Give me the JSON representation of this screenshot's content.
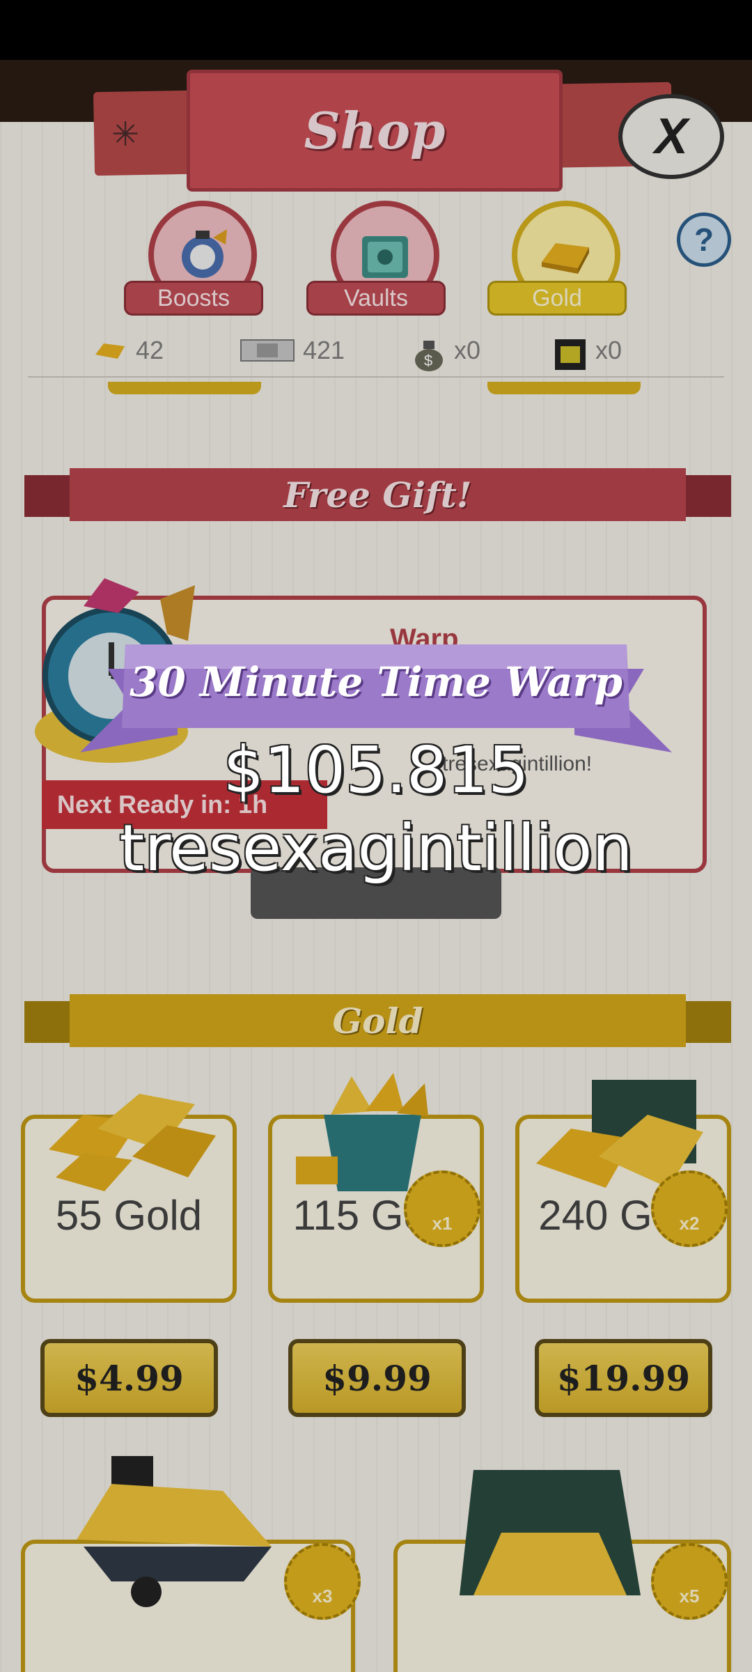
{
  "header": {
    "title": "Shop",
    "close_label": "X"
  },
  "tabs": [
    {
      "label": "Boosts",
      "selected": false
    },
    {
      "label": "Vaults",
      "selected": false
    },
    {
      "label": "Gold",
      "selected": true
    }
  ],
  "help_label": "?",
  "currencies": [
    {
      "icon": "gold-bar-icon",
      "value": "42"
    },
    {
      "icon": "megabucks-icon",
      "value": "421"
    },
    {
      "icon": "money-bag-icon",
      "value": "x0"
    },
    {
      "icon": "angel-ticket-icon",
      "value": "x0"
    }
  ],
  "free_gift": {
    "section_title": "Free Gift!",
    "card_title": "Warp",
    "card_desc": "tresexagintillion!",
    "next_ready": "Next Ready in: 1h"
  },
  "gold_section": {
    "title": "Gold",
    "items": [
      {
        "name": "55 Gold",
        "price": "$4.99",
        "multiplier": ""
      },
      {
        "name": "115 Gold",
        "price": "$9.99",
        "multiplier": "x1"
      },
      {
        "name": "240 Gold",
        "price": "$19.99",
        "multiplier": "x2"
      }
    ],
    "bottom_items": [
      {
        "multiplier": "x3"
      },
      {
        "multiplier": "x5"
      }
    ]
  },
  "reward_popup": {
    "title": "30 Minute Time Warp",
    "value_line1": "$105.815",
    "value_line2": "tresexagintillion"
  },
  "colors": {
    "accent_red": "#cc4e57",
    "gold": "#d5a91a",
    "ribbon_purple": "#9b7bc9"
  }
}
